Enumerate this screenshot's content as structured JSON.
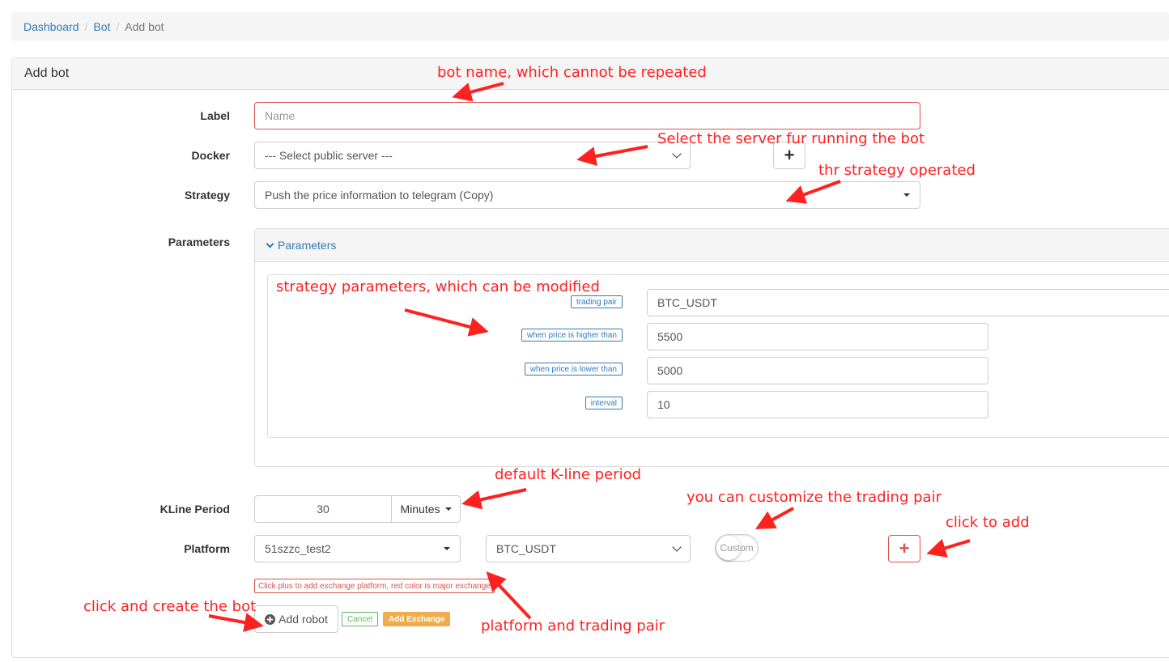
{
  "breadcrumb": {
    "items": [
      "Dashboard",
      "Bot"
    ],
    "active": "Add bot"
  },
  "panel": {
    "title": "Add bot"
  },
  "form": {
    "label": {
      "label": "Label",
      "placeholder": "Name"
    },
    "docker": {
      "label": "Docker",
      "value": "--- Select public server ---"
    },
    "strategy": {
      "label": "Strategy",
      "value": "Push the price information to telegram (Copy)"
    },
    "parameters": {
      "label": "Parameters",
      "heading": "Parameters",
      "items": [
        {
          "name": "trading pair",
          "value": "BTC_USDT"
        },
        {
          "name": "when price is higher than",
          "value": "5500"
        },
        {
          "name": "when price is lower than",
          "value": "5000"
        },
        {
          "name": "interval",
          "value": "10"
        }
      ]
    },
    "kline": {
      "label": "KLine Period",
      "value": "30",
      "unit": "Minutes"
    },
    "platform": {
      "label": "Platform",
      "exchange": "51szzc_test2",
      "pair": "BTC_USDT",
      "custom": "Custom",
      "help": "Click plus to add exchange platform, red color is major exchange"
    },
    "actions": {
      "add_robot": "Add robot",
      "cancel": "Cancel",
      "add_exchange": "Add Exchange"
    }
  },
  "colors": {
    "link": "#337ab7",
    "error": "#d9534f",
    "success": "#5cb85c",
    "warning": "#f0ad4e",
    "annotation": "#ff2020"
  },
  "annotations": {
    "bot_name": "bot name, which cannot be repeated",
    "server": "Select the server fur running the bot",
    "strategy": "thr strategy operated",
    "params": "strategy parameters, which can be modified",
    "kline": "default K-line period",
    "custom": "you can customize the trading pair",
    "click_add": "click to add",
    "create_bot": "click and create the bot",
    "platform_pair": "platform and trading pair"
  }
}
